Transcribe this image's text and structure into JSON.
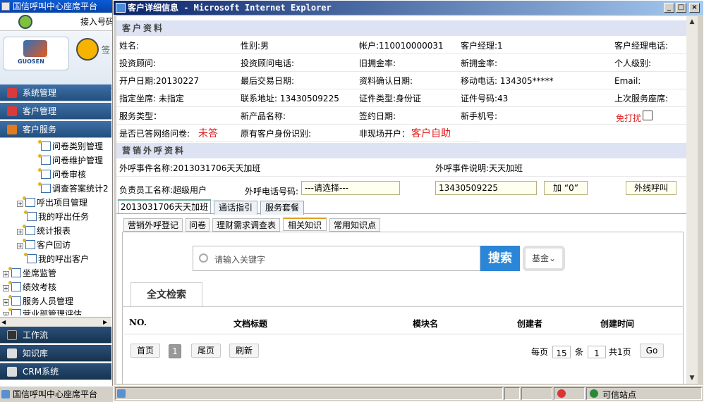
{
  "left_app": {
    "title": "国信呼叫中心座席平台",
    "toolbar_text": "接入号码",
    "logo_text": "GUOSEN",
    "logo_sub": "签",
    "menu_bars": [
      {
        "label": "系统管理",
        "color": "#d93a3a"
      },
      {
        "label": "客户管理",
        "color": "#d93a3a"
      },
      {
        "label": "客户服务",
        "color": "#e07b20"
      }
    ],
    "tree_items": [
      "问卷类别管理",
      "问卷维护管理",
      "问卷审核",
      "调查答案统计2",
      "呼出项目管理",
      "我的呼出任务",
      "统计报表",
      "客户回访",
      "我的呼出客户",
      "坐席监管",
      "绩效考核",
      "服务人员管理",
      "营业部管理评估"
    ],
    "bottom_bars": [
      "工作流",
      "知识库",
      "CRM系统"
    ],
    "status": "国信呼叫中心座席平台"
  },
  "window": {
    "title": "客户详细信息 - Microsoft Internet Explorer",
    "min": "_",
    "max": "□",
    "close": "×"
  },
  "customer_section": {
    "header": "客户资料",
    "rows": [
      [
        "姓名:",
        "性别:男",
        "帐户:110010000031",
        "客户经理:1",
        "客户经理电话:"
      ],
      [
        "投资顾问:",
        "投资顾问电话:",
        "旧拥金率:",
        "新拥金率:",
        "个人级别:"
      ],
      [
        "开户日期:20130227",
        "最后交易日期:",
        "资料确认日期:",
        "移动电话: 134305*****",
        "Email:"
      ],
      [
        "指定坐席: 未指定",
        "联系地址: 13430509225",
        "证件类型:身份证",
        "证件号码:43",
        "上次服务座席:"
      ],
      [
        "服务类型：",
        "新产品名称:",
        "签约日期:",
        "新手机号:",
        ""
      ]
    ],
    "no_disturb": "免打扰",
    "last_row": {
      "survey_label": "是否已答网络问卷:",
      "survey_value": "未答",
      "identity_label": "原有客户身份识别:",
      "open_label": "非现场开户：",
      "open_value": "客户自助"
    }
  },
  "call_section": {
    "header": "营销外呼资料",
    "event_name": "外呼事件名称:2013031706天天加班",
    "event_desc": "外呼事件说明:天天加班",
    "staff_name": "负责员工名称:超级用户",
    "phone_label": "外呼电话号码:",
    "phone_select": "---请选择---",
    "phone_value": "13430509225",
    "add_zero": "加 “0”",
    "dial_button": "外线呼叫"
  },
  "tabs": [
    "2013031706天天加班",
    "通话指引",
    "服务套餐"
  ],
  "subtabs": [
    "营销外呼登记",
    "问卷",
    "理财需求调查表",
    "相关知识",
    "常用知识点"
  ],
  "knowledge": {
    "search_placeholder": "请输入关键字",
    "search_button": "搜索",
    "filter": "基金",
    "fulltext_tab": "全文检索",
    "columns": [
      "NO.",
      "文档标题",
      "模块名",
      "创建者",
      "创建时间"
    ],
    "pager": {
      "first": "首页",
      "current_page": "1",
      "last": "尾页",
      "refresh": "刷新",
      "per_page_label": "每页",
      "per_page": "15",
      "unit": "条",
      "total_page": "1",
      "total_label": "共1页",
      "go": "Go"
    }
  },
  "ie_status": {
    "zone": "可信站点"
  }
}
